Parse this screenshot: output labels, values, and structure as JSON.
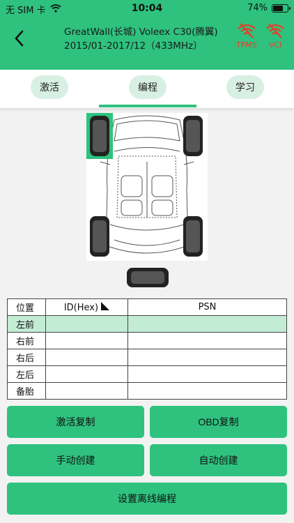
{
  "status": {
    "carrier": "无 SIM 卡",
    "time": "10:04",
    "battery": "74%",
    "battery_level": 0.74
  },
  "header": {
    "title": "GreatWall(长城) Voleex C30(腾翼) 2015/01-2017/12（433MHz）",
    "badges": [
      {
        "label": "TPMS",
        "color": "#e0432e"
      },
      {
        "label": "VCI",
        "color": "#e0432e"
      }
    ]
  },
  "tabs": [
    {
      "label": "激活"
    },
    {
      "label": "编程",
      "active": true
    },
    {
      "label": "学习"
    }
  ],
  "table": {
    "headers": {
      "position": "位置",
      "id": "ID(Hex)",
      "psn": "PSN"
    },
    "rows": [
      {
        "position": "左前",
        "id": "",
        "psn": "",
        "selected": true
      },
      {
        "position": "右前",
        "id": "",
        "psn": ""
      },
      {
        "position": "右后",
        "id": "",
        "psn": ""
      },
      {
        "position": "左后",
        "id": "",
        "psn": ""
      },
      {
        "position": "备胎",
        "id": "",
        "psn": ""
      }
    ]
  },
  "actions": {
    "activate_copy": "激活复制",
    "obd_copy": "OBD复制",
    "manual_create": "手动创建",
    "auto_create": "自动创建",
    "offline_program": "设置离线编程"
  },
  "colors": {
    "accent": "#2ec27e",
    "selected_row": "#c3ecd5",
    "alert": "#e0432e"
  }
}
